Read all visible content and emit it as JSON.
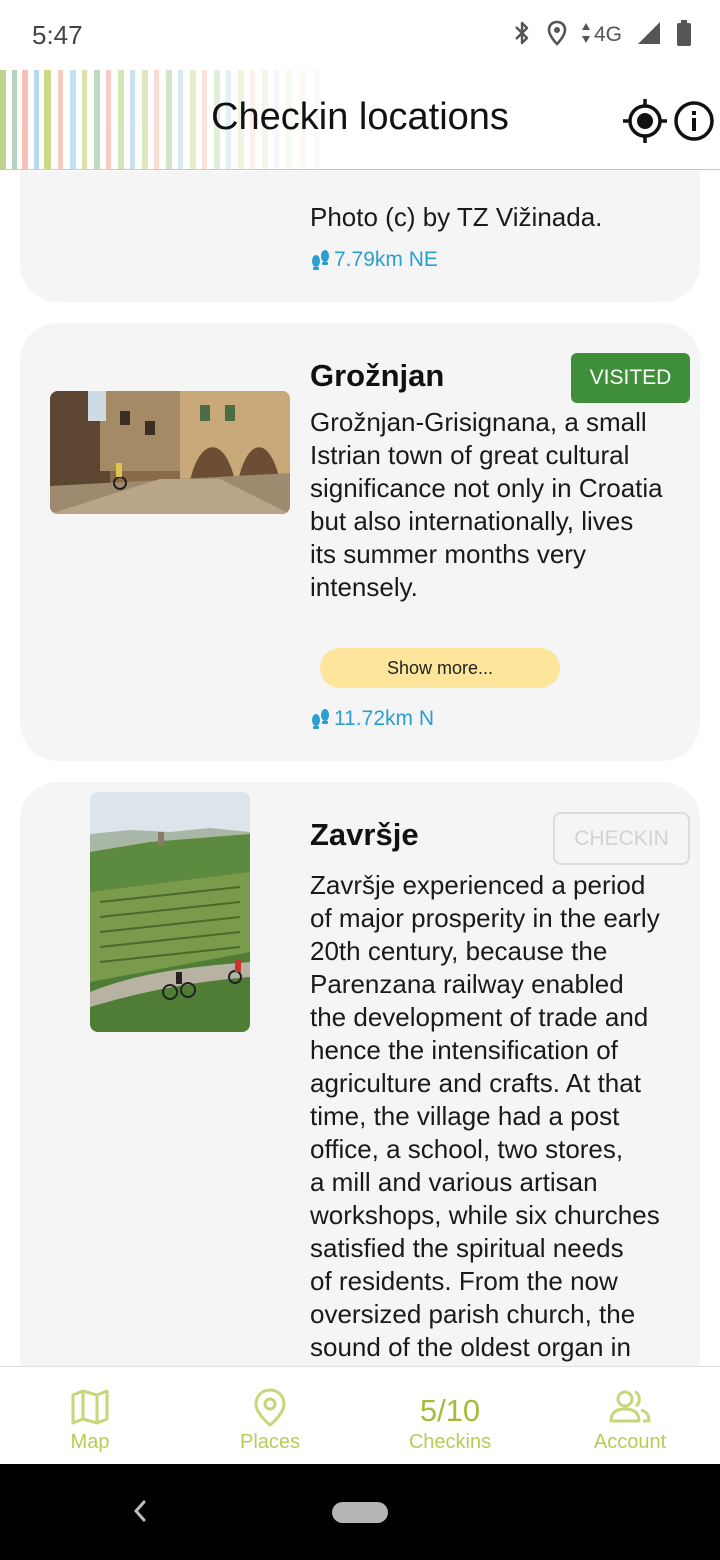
{
  "status_bar": {
    "time": "5:47",
    "network": "4G",
    "icons": [
      "bluetooth-icon",
      "location-pin-icon",
      "data-arrows-icon",
      "signal-icon",
      "battery-icon"
    ]
  },
  "header": {
    "title": "Checkin locations",
    "icons": [
      "crosshair-locate-icon",
      "info-icon"
    ]
  },
  "cards": [
    {
      "description": "Photo (c) by TZ Vižinada.",
      "distance": "7.79km NE"
    },
    {
      "title": "Grožnjan",
      "status": "VISITED",
      "description_lines": [
        "Grožnjan-Grisignana, a small",
        "Istrian town of great cultural",
        "significance not only in Croatia",
        "but also internationally, lives",
        "its summer months very",
        "intensely."
      ],
      "show_more": "Show more...",
      "distance": "11.72km N"
    },
    {
      "title": "Završje",
      "action": "CHECKIN",
      "description_lines": [
        "Završje experienced a period",
        "of major prosperity in the early",
        "20th century, because the",
        "Parenzana railway enabled",
        "the development of trade and",
        "hence the intensification of",
        "agriculture and crafts. At that",
        "time, the village had a post",
        "office, a school, two stores,",
        "a mill and various artisan",
        "workshops, while six churches",
        "satisfied the spiritual needs",
        "of residents. From the now",
        "oversized parish church, the",
        "sound of the oldest organ in"
      ]
    }
  ],
  "bottom_nav": {
    "map": "Map",
    "places": "Places",
    "checkins_count": "5/10",
    "checkins": "Checkins",
    "account": "Account"
  },
  "colors": {
    "accent": "#b8cc55",
    "visited": "#3f8f3a",
    "distance": "#2a9fd0",
    "show_more_bg": "#fde59c",
    "card_bg": "#f5f5f5"
  }
}
